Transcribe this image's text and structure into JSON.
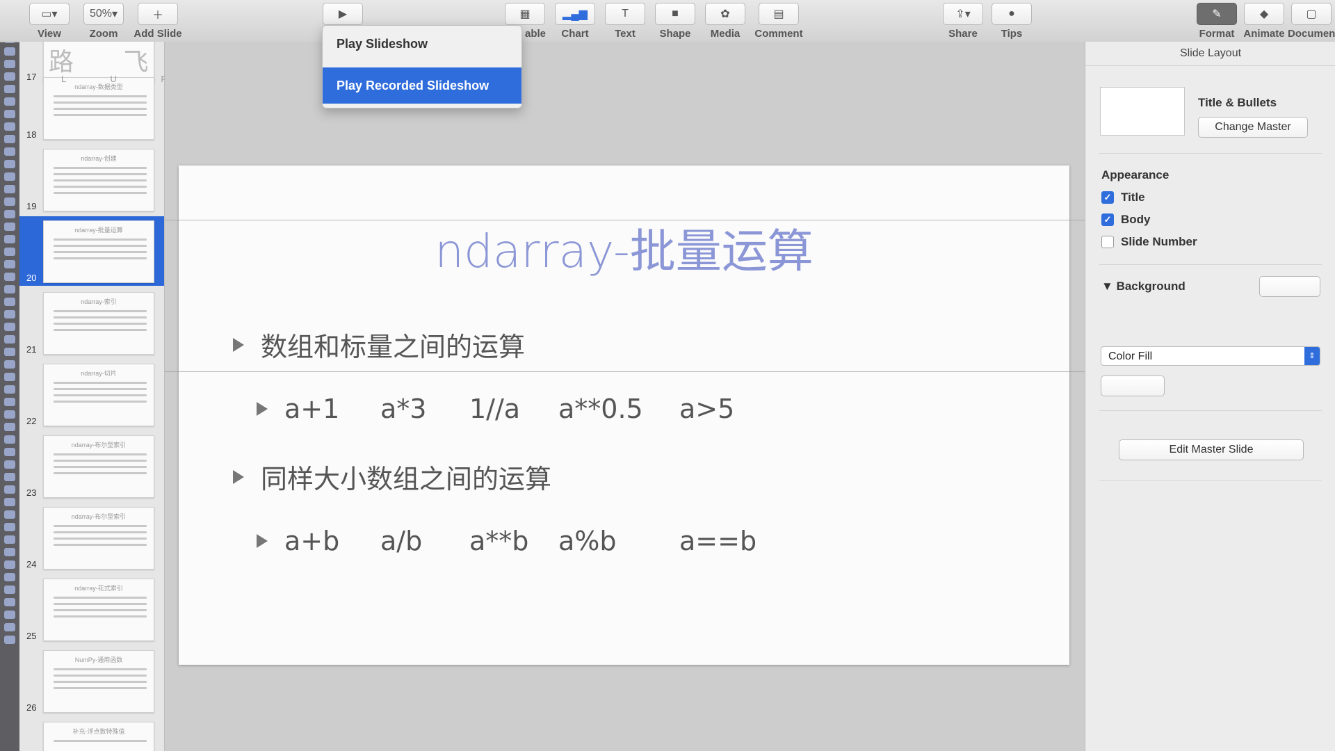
{
  "toolbar": {
    "left": [
      {
        "label": "View",
        "icon": "sidebar-icon"
      },
      {
        "label": "Zoom",
        "value": "50%"
      },
      {
        "label": "Add Slide",
        "icon": "plus-icon"
      }
    ],
    "center": [
      {
        "label": "able",
        "icon": "table-icon"
      },
      {
        "label": "Chart",
        "icon": "chart-icon"
      },
      {
        "label": "Text",
        "icon": "text-icon"
      },
      {
        "label": "Shape",
        "icon": "shape-icon"
      },
      {
        "label": "Media",
        "icon": "media-icon"
      },
      {
        "label": "Comment",
        "icon": "comment-icon"
      }
    ],
    "share": {
      "label": "Share"
    },
    "tips": {
      "label": "Tips"
    },
    "tabs": [
      {
        "label": "Format",
        "icon": "paintbrush-icon"
      },
      {
        "label": "Animate",
        "icon": "diamond-icon"
      },
      {
        "label": "Document",
        "icon": "document-icon"
      }
    ]
  },
  "play_menu": {
    "items": [
      "Play Slideshow",
      "Play Recorded Slideshow"
    ]
  },
  "brand": {
    "text": "路 飞 学 城",
    "sub": "L U F F Y C I T Y"
  },
  "navigator": {
    "slides": [
      {
        "num": "17",
        "title": ""
      },
      {
        "num": "18",
        "title": "ndarray-数据类型"
      },
      {
        "num": "19",
        "title": "ndarray-创建"
      },
      {
        "num": "20",
        "title": "ndarray-批量运算",
        "selected": true
      },
      {
        "num": "21",
        "title": "ndarray-索引"
      },
      {
        "num": "22",
        "title": "ndarray-切片"
      },
      {
        "num": "23",
        "title": "ndarray-布尔型索引"
      },
      {
        "num": "24",
        "title": "ndarray-布尔型索引"
      },
      {
        "num": "25",
        "title": "ndarray-花式索引"
      },
      {
        "num": "26",
        "title": "NumPy-通用函数"
      },
      {
        "num": "",
        "title": "补充-浮点数特殊值"
      }
    ]
  },
  "slide": {
    "title": "ndarray-批量运算",
    "bullet1": "数组和标量之间的运算",
    "exprs1": [
      "a+1",
      "a*3",
      "1//a",
      "a**0.5",
      "a>5"
    ],
    "bullet2": "同样大小数组之间的运算",
    "exprs2": [
      "a+b",
      "a/b",
      "a**b",
      "a%b",
      "a==b"
    ]
  },
  "inspector": {
    "header": "Slide Layout",
    "layout_name": "Title & Bullets",
    "change_master": "Change Master",
    "appearance_label": "Appearance",
    "checks": [
      {
        "label": "Title",
        "checked": true
      },
      {
        "label": "Body",
        "checked": true
      },
      {
        "label": "Slide Number",
        "checked": false
      }
    ],
    "background_label": "Background",
    "fill_select": "Color Fill",
    "edit_master": "Edit Master Slide"
  },
  "colors": {
    "accent": "#2f6ddd",
    "title": "#8b96d6"
  }
}
